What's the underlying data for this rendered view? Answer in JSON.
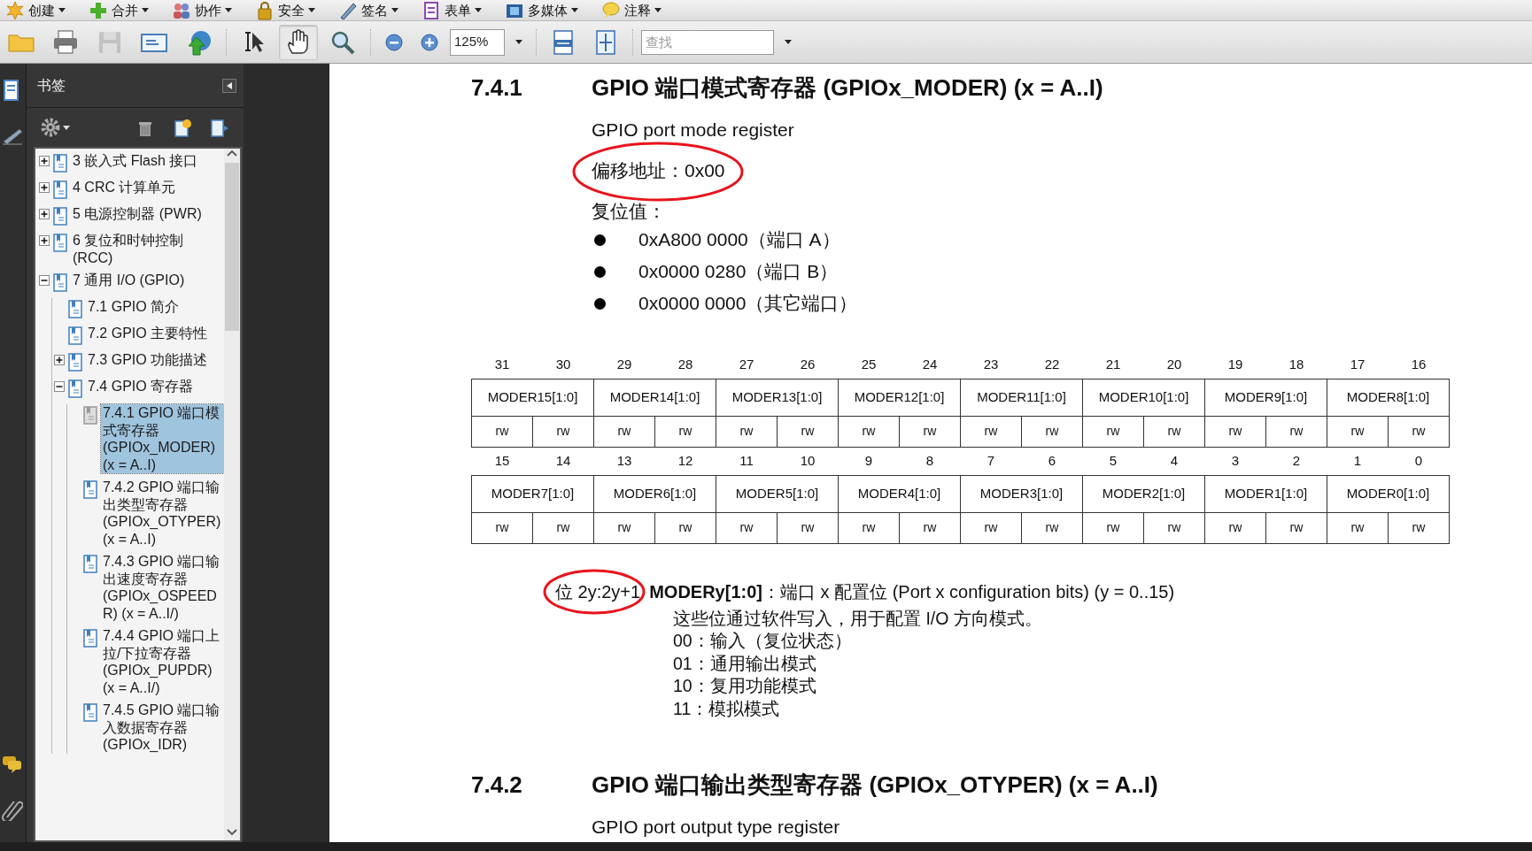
{
  "menu_bar": [
    {
      "label": "创建"
    },
    {
      "label": "合并"
    },
    {
      "label": "协作"
    },
    {
      "label": "安全"
    },
    {
      "label": "签名"
    },
    {
      "label": "表单"
    },
    {
      "label": "多媒体"
    },
    {
      "label": "注释"
    }
  ],
  "toolbar": {
    "file_buttons": [
      {
        "disabled": false
      },
      {
        "disabled": false
      },
      {
        "disabled": true
      },
      {
        "disabled": false
      },
      {
        "disabled": false
      }
    ],
    "tools": [
      {
        "selected": false
      },
      {
        "selected": true
      },
      {
        "selected": false
      }
    ],
    "zoom": "125%",
    "search": {
      "placeholder": "查找"
    }
  },
  "bookmarks": {
    "title": "书签",
    "items": [
      {
        "label": "3 嵌入式 Flash 接口",
        "expandable": true,
        "expanded": false,
        "selected": false
      },
      {
        "label": "4 CRC 计算单元",
        "expandable": true,
        "expanded": false,
        "selected": false
      },
      {
        "label": "5 电源控制器 (PWR)",
        "expandable": true,
        "expanded": false,
        "selected": false
      },
      {
        "label": "6 复位和时钟控制 (RCC)",
        "expandable": true,
        "expanded": false,
        "selected": false
      },
      {
        "label": "7 通用 I/O (GPIO)",
        "expandable": true,
        "expanded": true,
        "selected": false,
        "children": [
          {
            "label": "7.1 GPIO 简介",
            "expandable": false,
            "expanded": false,
            "selected": false
          },
          {
            "label": "7.2 GPIO 主要特性",
            "expandable": false,
            "expanded": false,
            "selected": false
          },
          {
            "label": "7.3 GPIO 功能描述",
            "expandable": true,
            "expanded": false,
            "selected": false
          },
          {
            "label": "7.4 GPIO 寄存器",
            "expandable": true,
            "expanded": true,
            "selected": false,
            "children": [
              {
                "label": "7.4.1 GPIO 端口模式寄存器 (GPIOx_MODER) (x = A..I)",
                "expandable": false,
                "expanded": false,
                "selected": true
              },
              {
                "label": "7.4.2 GPIO 端口输出类型寄存器 (GPIOx_OTYPER) (x = A..I)",
                "expandable": false,
                "expanded": false,
                "selected": false
              },
              {
                "label": "7.4.3 GPIO 端口输出速度寄存器 (GPIOx_OSPEEDR) (x = A..I/)",
                "expandable": false,
                "expanded": false,
                "selected": false
              },
              {
                "label": "7.4.4 GPIO 端口上拉/下拉寄存器 (GPIOx_PUPDR) (x = A..I/)",
                "expandable": false,
                "expanded": false,
                "selected": false
              },
              {
                "label": "7.4.5 GPIO 端口输入数据寄存器 (GPIOx_IDR)",
                "expandable": false,
                "expanded": false,
                "selected": false
              }
            ]
          }
        ]
      }
    ]
  },
  "document": {
    "section": {
      "number": "7.4.1",
      "title": "GPIO 端口模式寄存器 (GPIOx_MODER) (x = A..I)",
      "subtitle": "GPIO port mode register",
      "offset": {
        "text": "偏移地址：0x00",
        "circled": true
      },
      "reset_label": "复位值：",
      "reset_values": [
        "0xA800 0000（端口 A）",
        "0x0000 0280（端口 B）",
        "0x0000 0000（其它端口）"
      ],
      "register_rows": [
        {
          "bits": [
            "31",
            "30",
            "29",
            "28",
            "27",
            "26",
            "25",
            "24",
            "23",
            "22",
            "21",
            "20",
            "19",
            "18",
            "17",
            "16"
          ],
          "fields": [
            "MODER15[1:0]",
            "MODER14[1:0]",
            "MODER13[1:0]",
            "MODER12[1:0]",
            "MODER11[1:0]",
            "MODER10[1:0]",
            "MODER9[1:0]",
            "MODER8[1:0]"
          ],
          "access": [
            "rw",
            "rw",
            "rw",
            "rw",
            "rw",
            "rw",
            "rw",
            "rw",
            "rw",
            "rw",
            "rw",
            "rw",
            "rw",
            "rw",
            "rw",
            "rw"
          ]
        },
        {
          "bits": [
            "15",
            "14",
            "13",
            "12",
            "11",
            "10",
            "9",
            "8",
            "7",
            "6",
            "5",
            "4",
            "3",
            "2",
            "1",
            "0"
          ],
          "fields": [
            "MODER7[1:0]",
            "MODER6[1:0]",
            "MODER5[1:0]",
            "MODER4[1:0]",
            "MODER3[1:0]",
            "MODER2[1:0]",
            "MODER1[1:0]",
            "MODER0[1:0]"
          ],
          "access": [
            "rw",
            "rw",
            "rw",
            "rw",
            "rw",
            "rw",
            "rw",
            "rw",
            "rw",
            "rw",
            "rw",
            "rw",
            "rw",
            "rw",
            "rw",
            "rw"
          ]
        }
      ],
      "bit_range": {
        "text": "位 2y:2y+1",
        "circled": true
      },
      "field_description": "**MODERy[1:0]**：端口 x 配置位 (Port x configuration bits) (y = 0..15)",
      "description_lines": [
        "这些位通过软件写入，用于配置 I/O 方向模式。",
        "00：输入（复位状态）",
        "01：通用输出模式",
        "10：复用功能模式",
        "11：模拟模式"
      ]
    },
    "next_section": {
      "number": "7.4.2",
      "title": "GPIO 端口输出类型寄存器 (GPIOx_OTYPER) (x = A..I)",
      "subtitle": "GPIO port output type register"
    }
  }
}
